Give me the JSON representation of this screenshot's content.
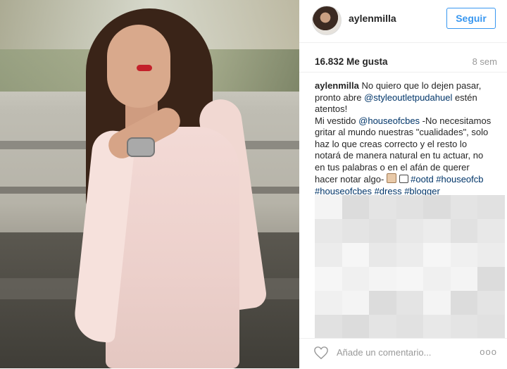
{
  "post": {
    "username": "aylenmilla",
    "follow_label": "Seguir",
    "likes": "16.832 Me gusta",
    "time": "8 sem"
  },
  "caption": {
    "lines": [
      {
        "user": "aylenmilla",
        "text": " No quiero que lo dejen pasar,"
      },
      {
        "text": "pronto abre ",
        "link": "@styleoutletpudahuel",
        "after": " estén"
      },
      {
        "text": "atentos!"
      },
      {
        "text": "Mi vestido ",
        "link": "@houseofcbes",
        "after": " -No necesitamos"
      },
      {
        "text": "gritar al mundo nuestras \"cualidades\", solo"
      },
      {
        "text": "haz lo que creas correcto y el resto lo"
      },
      {
        "text": "notará de manera natural en tu actuar, no"
      },
      {
        "text": "en tus palabras o en el afán de querer"
      },
      {
        "text": "hacer notar algo-",
        "emoji": [
          "hands-emoji",
          "grid-emoji"
        ],
        "link": " #ootd #houseofcb"
      },
      {
        "link": "#houseofcbes #dress #blogger"
      }
    ]
  },
  "comments_placeholder": "Añade un comentario...",
  "more_label": "ooo",
  "colors": {
    "accent": "#3897f0",
    "link": "#003569",
    "muted": "#999999"
  },
  "icons": {
    "like": "heart-icon",
    "options": "more-options-icon"
  }
}
